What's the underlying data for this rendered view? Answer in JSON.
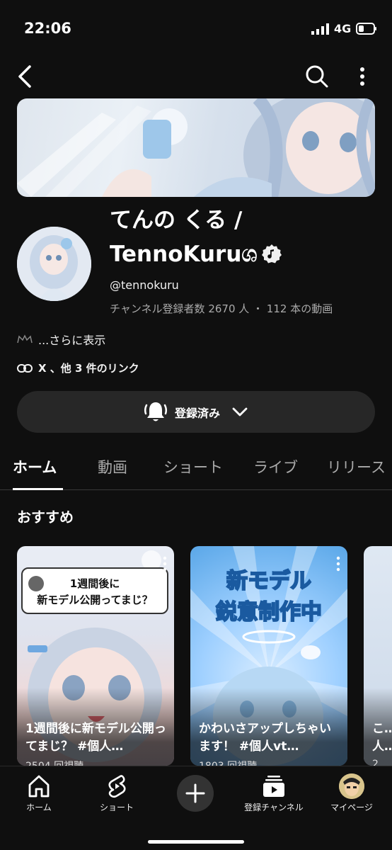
{
  "status": {
    "time": "22:06",
    "network": "4G"
  },
  "channel": {
    "name": "てんの くる / TennoKuru",
    "name_suffix": "ශ",
    "handle": "@tennokuru",
    "stats": "チャンネル登録者数 2670 人 ・ 112 本の動画",
    "description": "...さらに表示",
    "links": "X 、他 3 件のリンク"
  },
  "subscribe": {
    "label": "登録済み"
  },
  "tabs": [
    {
      "label": "ホーム",
      "active": true
    },
    {
      "label": "動画"
    },
    {
      "label": "ショート"
    },
    {
      "label": "ライブ"
    },
    {
      "label": "リリース"
    }
  ],
  "section": {
    "title": "おすすめ"
  },
  "shorts": [
    {
      "overlay_text": "1週間後に\n新モデル公開ってまじ？",
      "title": "1週間後に新モデル公開ってまじ？ #個人…",
      "views": "2504 回視聴"
    },
    {
      "overlay_text": "新モデル\n鋭意制作中",
      "title": "かわいさアップしちゃいます！ #個人vt…",
      "views": "1803 回視聴"
    },
    {
      "title": "こ…\n人…",
      "views": "2…"
    }
  ],
  "bottom_nav": {
    "home": "ホーム",
    "shorts": "ショート",
    "subscriptions": "登録チャンネル",
    "mypage": "マイページ"
  },
  "colors": {
    "background": "#0f0f0f",
    "surface": "#272727",
    "text": "#f1f1f1",
    "muted": "#aaaaaa"
  }
}
